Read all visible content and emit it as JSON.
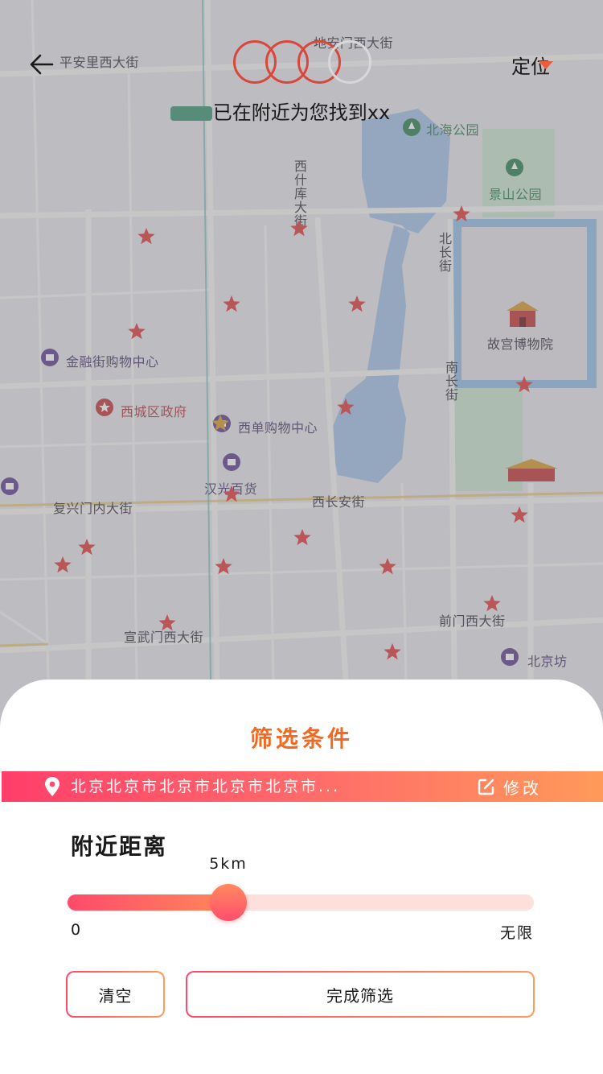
{
  "header": {
    "found_text": "已在附近为您找到xx",
    "locate_label": "定位"
  },
  "map": {
    "labels": {
      "pinganli": "平安里西大街",
      "dianmen": "地安门西大街",
      "beihai": "北海公园",
      "jingshan": "景山公园",
      "xishiku": "西什库大街",
      "beichang": "北长街",
      "gugong": "故宫博物院",
      "nanchang": "南长街",
      "jinrong": "金融街购物中心",
      "xicheng": "西城区政府",
      "xidan": "西单购物中心",
      "hanguang": "汉光百货",
      "fuxingmen": "复兴门内大街",
      "xichangan": "西长安街",
      "xuanwumen": "宣武门西大街",
      "qianmen": "前门西大街",
      "beijingfang": "北京坊"
    },
    "colors": {
      "star": "#e04a4a",
      "water": "#a9c7e8",
      "park": "#cfe6d2",
      "road": "#f7f6f3"
    }
  },
  "filter": {
    "title": "筛选条件",
    "address": "北京北京市北京市北京市北京市...",
    "edit_label": "修改",
    "distance_title": "附近距离",
    "distance_value": "5km",
    "slider_fraction": 0.35,
    "slider_min": "0",
    "slider_max": "无限",
    "clear_label": "清空",
    "done_label": "完成筛选",
    "accent_start": "#ff4a6a",
    "accent_end": "#ff9a5a",
    "title_color": "#f26a22"
  }
}
